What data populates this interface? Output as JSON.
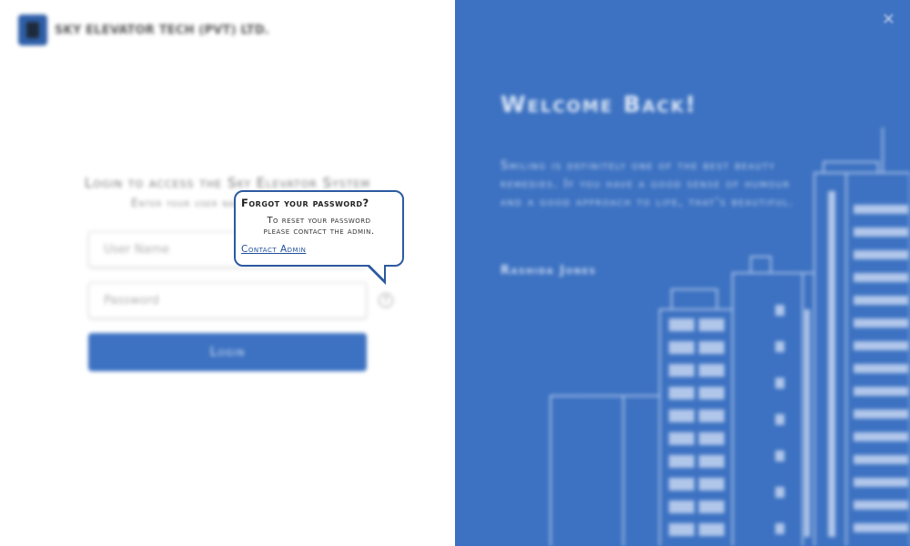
{
  "brand": {
    "name": "SKY ELEVATOR TECH (PVT) LTD.",
    "logo_icon": "elevator-logo-icon"
  },
  "login": {
    "title": "Login to access the Sky Elevator System",
    "subtitle": "Enter your user name and password",
    "username_placeholder": "User Name",
    "password_placeholder": "Password",
    "help_icon": "?",
    "button_label": "Login"
  },
  "tooltip": {
    "title": "Forgot your password?",
    "body_line1": "To reset your password",
    "body_line2": "please contact the admin.",
    "link": "Contact Admin"
  },
  "welcome": {
    "close_icon": "×",
    "heading": "Welcome Back!",
    "quote": "Smiling is definitely one of the best beauty remedies. If you have a good sense of humour and a good approach to life, that's beautiful.",
    "author": "Rashida Jones"
  },
  "colors": {
    "accent": "#3d72c2",
    "tooltip_border": "#2c5aa0",
    "link": "#1f4f9a"
  }
}
